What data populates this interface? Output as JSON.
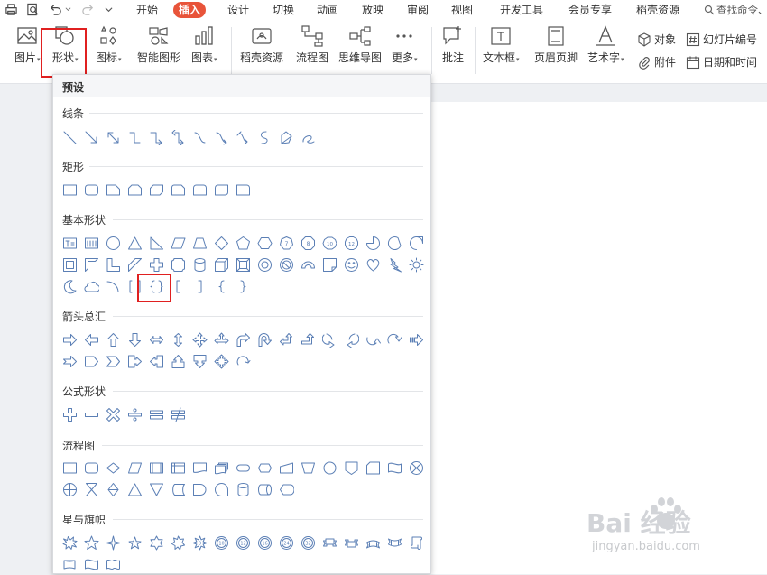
{
  "menubar": {
    "tabs": [
      "开始",
      "插入",
      "设计",
      "切换",
      "动画",
      "放映",
      "审阅",
      "视图",
      "开发工具",
      "会员专享",
      "稻壳资源"
    ],
    "active_tab": "插入",
    "search_label": "查找命令、"
  },
  "ribbon": {
    "picture": "图片",
    "shape": "形状",
    "icon": "图标",
    "smartart": "智能图形",
    "chart": "图表",
    "docer": "稻壳资源",
    "flowchart": "流程图",
    "mindmap": "思维导图",
    "more": "更多",
    "comment": "批注",
    "textbox": "文本框",
    "header_footer": "页眉页脚",
    "wordart": "艺术字",
    "object": "对象",
    "attachment": "附件",
    "slide_number": "幻灯片编号",
    "date_time": "日期和时间"
  },
  "panel": {
    "title": "预设",
    "sections": {
      "lines": "线条",
      "rectangles": "矩形",
      "basic": "基本形状",
      "arrows": "箭头总汇",
      "equation": "公式形状",
      "flowchart": "流程图",
      "stars": "星与旗帜"
    }
  },
  "watermark": {
    "logo": "Bai 经验",
    "url": "jingyan.baidu.com"
  },
  "colors": {
    "accent": "#e8543a",
    "highlight": "#e02020",
    "shape_stroke": "#5b7fb5"
  }
}
